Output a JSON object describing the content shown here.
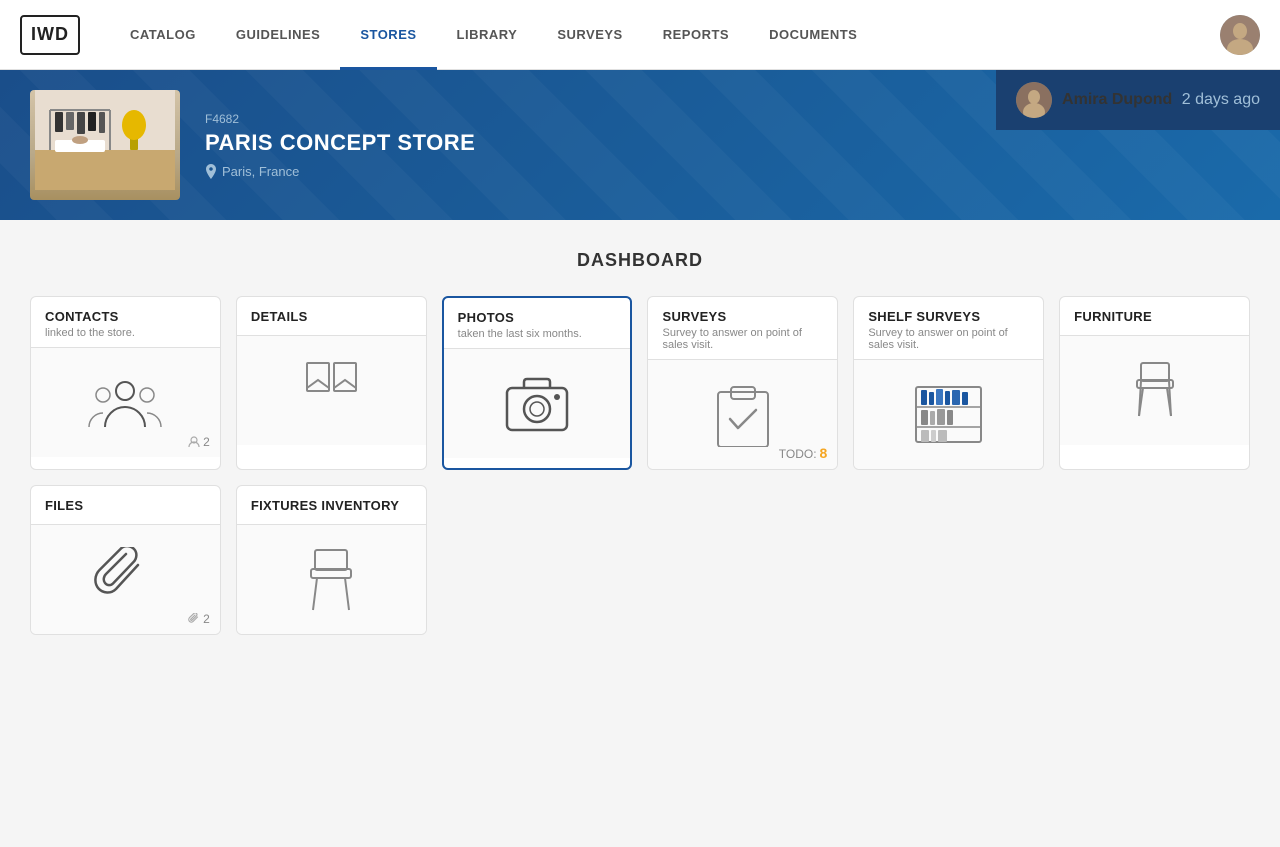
{
  "logo": {
    "text": "IWD"
  },
  "nav": {
    "items": [
      {
        "label": "CATALOG",
        "active": false
      },
      {
        "label": "GUIDELINES",
        "active": false
      },
      {
        "label": "STORES",
        "active": true
      },
      {
        "label": "LIBRARY",
        "active": false
      },
      {
        "label": "SURVEYS",
        "active": false
      },
      {
        "label": "REPORTS",
        "active": false
      },
      {
        "label": "DOCUMENTS",
        "active": false
      }
    ]
  },
  "store": {
    "code": "F4682",
    "name": "PARIS CONCEPT STORE",
    "location": "Paris, France",
    "activity": {
      "user": "Amira Dupond",
      "time": "2 days ago"
    }
  },
  "dashboard": {
    "title": "DASHBOARD",
    "cards_row1": [
      {
        "id": "contacts",
        "title": "CONTACTS",
        "subtitle": "linked to the store.",
        "count": "2",
        "count_icon": "person",
        "active": false
      },
      {
        "id": "details",
        "title": "DETAILS",
        "subtitle": "",
        "active": false
      },
      {
        "id": "photos",
        "title": "PHOTOS",
        "subtitle": "taken the last six months.",
        "active": true
      },
      {
        "id": "surveys",
        "title": "SURVEYS",
        "subtitle": "Survey to answer on point of sales visit.",
        "todo": "8",
        "active": false
      },
      {
        "id": "shelf-surveys",
        "title": "SHELF SURVEYS",
        "subtitle": "Survey to answer on point of sales visit.",
        "active": false
      },
      {
        "id": "furniture",
        "title": "FURNITURE",
        "subtitle": "",
        "active": false
      }
    ],
    "cards_row2": [
      {
        "id": "files",
        "title": "FILES",
        "subtitle": "",
        "count": "2",
        "active": false
      },
      {
        "id": "fixtures-inventory",
        "title": "FIXTURES INVENTORY",
        "subtitle": "",
        "active": false
      }
    ]
  }
}
